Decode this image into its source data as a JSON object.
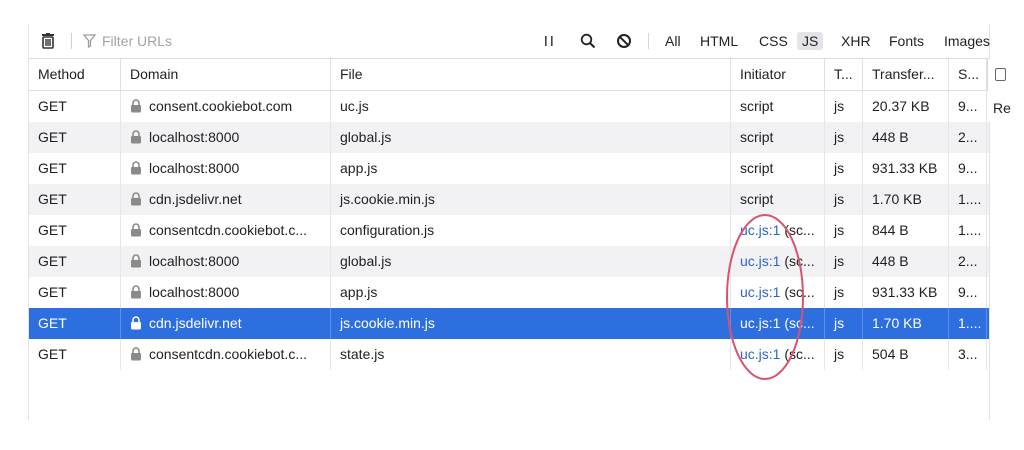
{
  "toolbar": {
    "filter_placeholder": "Filter URLs",
    "type_filters": [
      "All",
      "HTML",
      "CSS",
      "JS",
      "XHR",
      "Fonts",
      "Images"
    ],
    "active_filter": "JS"
  },
  "columns": [
    "Method",
    "Domain",
    "File",
    "Initiator",
    "T...",
    "Transfer...",
    "S...",
    "Re"
  ],
  "rows": [
    {
      "method": "GET",
      "domain": "consent.cookiebot.com",
      "file": "uc.js",
      "initiator": "script",
      "initiator_link": "",
      "type": "js",
      "transferred": "20.37 KB",
      "size": "9...",
      "selected": false
    },
    {
      "method": "GET",
      "domain": "localhost:8000",
      "file": "global.js",
      "initiator": "script",
      "initiator_link": "",
      "type": "js",
      "transferred": "448 B",
      "size": "2...",
      "selected": false
    },
    {
      "method": "GET",
      "domain": "localhost:8000",
      "file": "app.js",
      "initiator": "script",
      "initiator_link": "",
      "type": "js",
      "transferred": "931.33 KB",
      "size": "9...",
      "selected": false
    },
    {
      "method": "GET",
      "domain": "cdn.jsdelivr.net",
      "file": "js.cookie.min.js",
      "initiator": "script",
      "initiator_link": "",
      "type": "js",
      "transferred": "1.70 KB",
      "size": "1....",
      "selected": false
    },
    {
      "method": "GET",
      "domain": "consentcdn.cookiebot.c...",
      "file": "configuration.js",
      "initiator": " (sc...",
      "initiator_link": "uc.js:1",
      "type": "js",
      "transferred": "844 B",
      "size": "1....",
      "selected": false
    },
    {
      "method": "GET",
      "domain": "localhost:8000",
      "file": "global.js",
      "initiator": " (sc...",
      "initiator_link": "uc.js:1",
      "type": "js",
      "transferred": "448 B",
      "size": "2...",
      "selected": false
    },
    {
      "method": "GET",
      "domain": "localhost:8000",
      "file": "app.js",
      "initiator": " (sc...",
      "initiator_link": "uc.js:1",
      "type": "js",
      "transferred": "931.33 KB",
      "size": "9...",
      "selected": false
    },
    {
      "method": "GET",
      "domain": "cdn.jsdelivr.net",
      "file": "js.cookie.min.js",
      "initiator": " (sc...",
      "initiator_link": "uc.js:1",
      "type": "js",
      "transferred": "1.70 KB",
      "size": "1....",
      "selected": true
    },
    {
      "method": "GET",
      "domain": "consentcdn.cookiebot.c...",
      "file": "state.js",
      "initiator": " (sc...",
      "initiator_link": "uc.js:1",
      "type": "js",
      "transferred": "504 B",
      "size": "3...",
      "selected": false
    }
  ],
  "colors": {
    "selected_row": "#2e6fe0",
    "link": "#2b64d1",
    "annotation": "#d9536f"
  }
}
